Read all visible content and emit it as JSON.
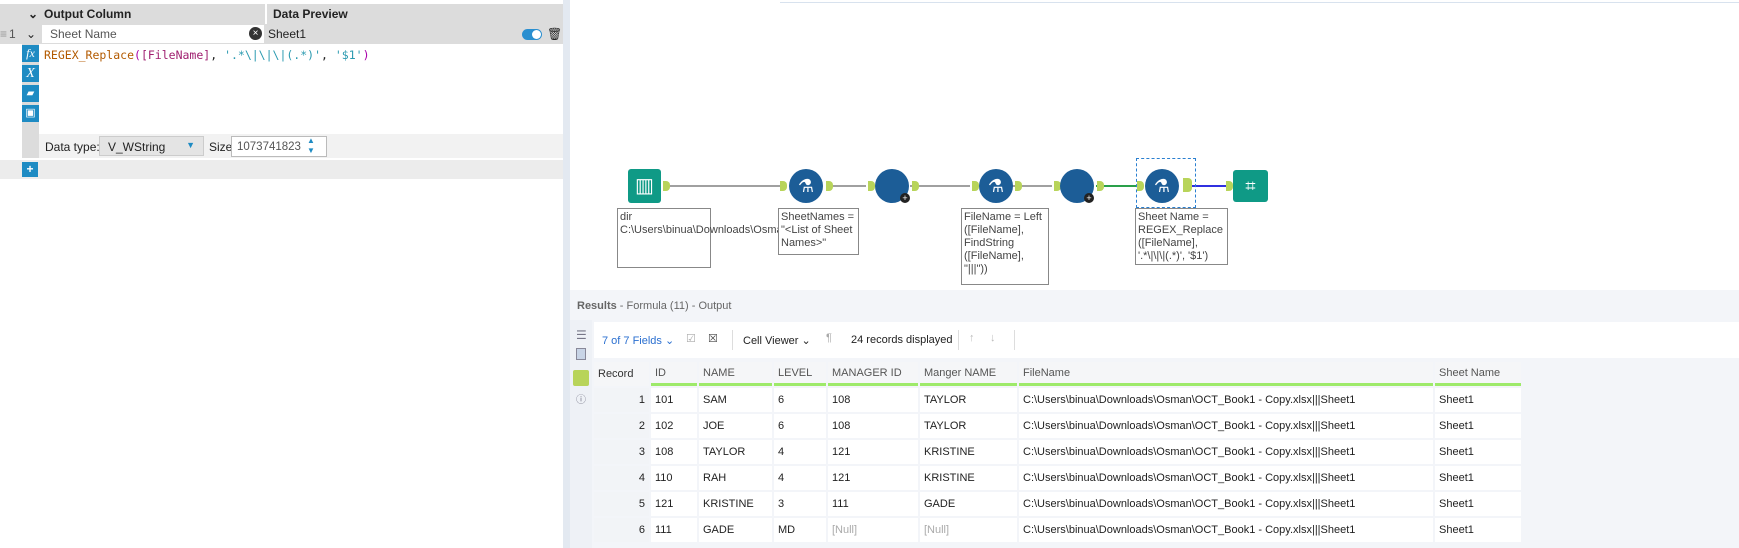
{
  "formula_panel": {
    "headers": {
      "output_column": "Output Column",
      "data_preview": "Data Preview"
    },
    "row": {
      "index": "1",
      "output_column": "Sheet Name",
      "data_preview": "Sheet1"
    },
    "expression": {
      "func": "REGEX_Replace",
      "field": "[FileName]",
      "pattern": "'.*\\|\\|\\|(.*)'",
      "replacement": "'$1'"
    },
    "data_type_label": "Data type:",
    "data_type": "V_WString",
    "size_label": "Size:",
    "size": "1073741823"
  },
  "canvas": {
    "annotations": {
      "input": "dir C:\\Users\\binua\\Downloads\\Osman\\*.xlsx",
      "formula1": "SheetNames = \"<List of Sheet Names>\"",
      "formula2": "FileName = Left ([FileName], FindString ([FileName], \"|||\"))",
      "formula3": "Sheet Name = REGEX_Replace ([FileName], '.*\\|\\|\\|(.*)', '$1')"
    }
  },
  "results": {
    "title": "Results",
    "subtitle": " - Formula (11) - Output",
    "fields": "7 of 7 Fields",
    "cell_viewer": "Cell Viewer",
    "records": "24 records displayed",
    "columns": [
      "Record",
      "ID",
      "NAME",
      "LEVEL",
      "MANAGER ID",
      "Manger NAME",
      "FileName",
      "Sheet Name"
    ],
    "rows": [
      [
        "1",
        "101",
        "SAM",
        "6",
        "108",
        "TAYLOR",
        "C:\\Users\\binua\\Downloads\\Osman\\OCT_Book1 - Copy.xlsx|||Sheet1",
        "Sheet1"
      ],
      [
        "2",
        "102",
        "JOE",
        "6",
        "108",
        "TAYLOR",
        "C:\\Users\\binua\\Downloads\\Osman\\OCT_Book1 - Copy.xlsx|||Sheet1",
        "Sheet1"
      ],
      [
        "3",
        "108",
        "TAYLOR",
        "4",
        "121",
        "KRISTINE",
        "C:\\Users\\binua\\Downloads\\Osman\\OCT_Book1 - Copy.xlsx|||Sheet1",
        "Sheet1"
      ],
      [
        "4",
        "110",
        "RAH",
        "4",
        "121",
        "KRISTINE",
        "C:\\Users\\binua\\Downloads\\Osman\\OCT_Book1 - Copy.xlsx|||Sheet1",
        "Sheet1"
      ],
      [
        "5",
        "121",
        "KRISTINE",
        "3",
        "111",
        "GADE",
        "C:\\Users\\binua\\Downloads\\Osman\\OCT_Book1 - Copy.xlsx|||Sheet1",
        "Sheet1"
      ],
      [
        "6",
        "111",
        "GADE",
        "MD",
        "[Null]",
        "[Null]",
        "C:\\Users\\binua\\Downloads\\Osman\\OCT_Book1 - Copy.xlsx|||Sheet1",
        "Sheet1"
      ]
    ]
  }
}
